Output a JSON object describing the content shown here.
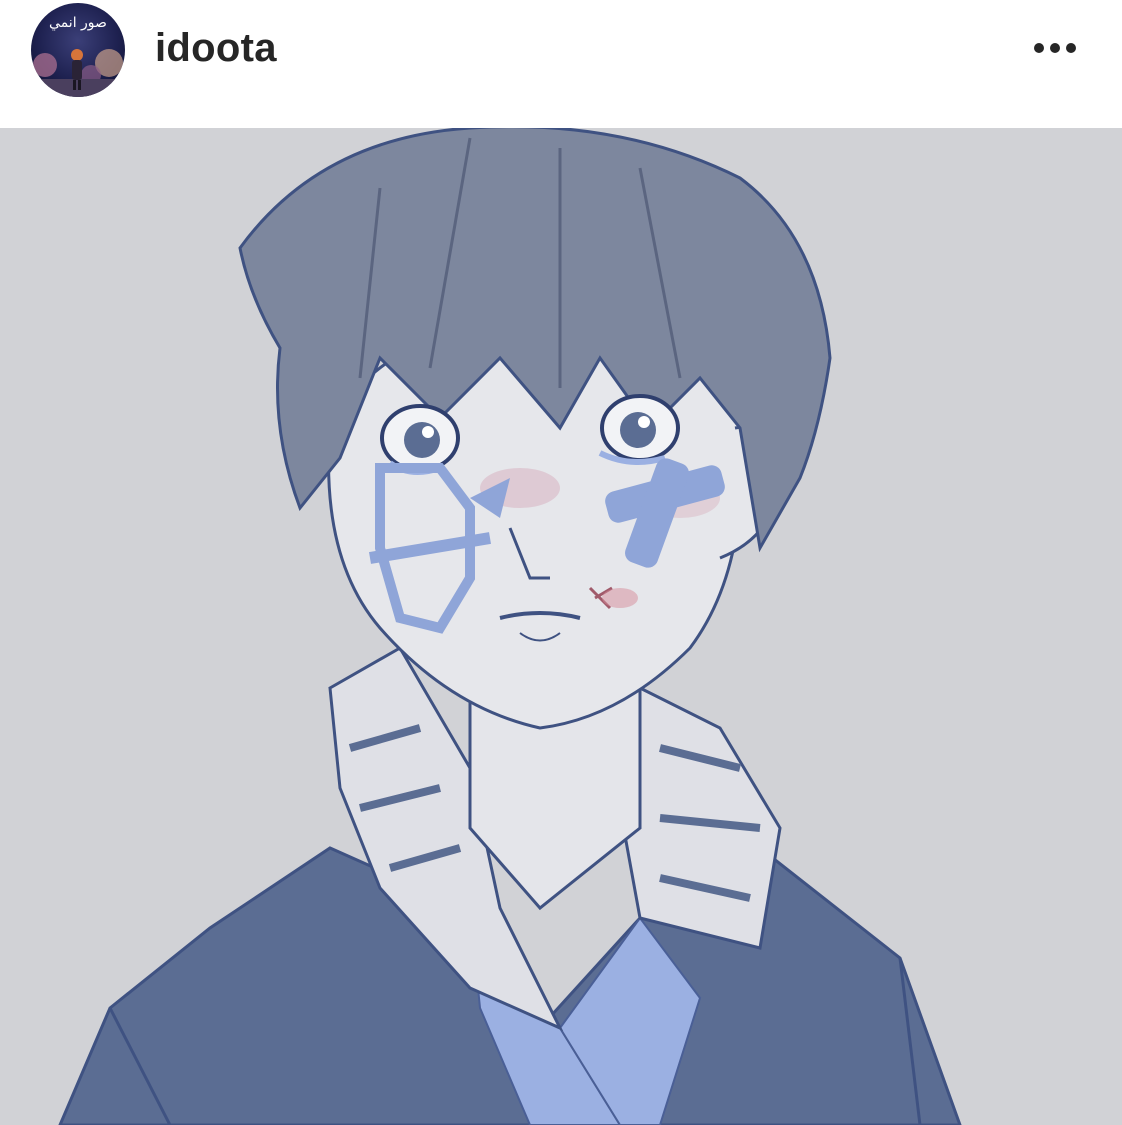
{
  "post": {
    "author": {
      "username": "idoota",
      "avatar_caption": "صور انمي",
      "avatar_icon": "profile-avatar-icon"
    },
    "more_icon": "more-options-icon",
    "image": {
      "subject": "anime-boy-illustration"
    }
  },
  "colors": {
    "header_bg": "#ffffff",
    "username_text": "#262626",
    "image_bg": "#d1d2d6",
    "hair": "#7d879e",
    "vest": "#5b6d93",
    "bandage": "#8fa5d8",
    "scarf": "#dfe0e6",
    "shirt": "#9bb0e2"
  }
}
